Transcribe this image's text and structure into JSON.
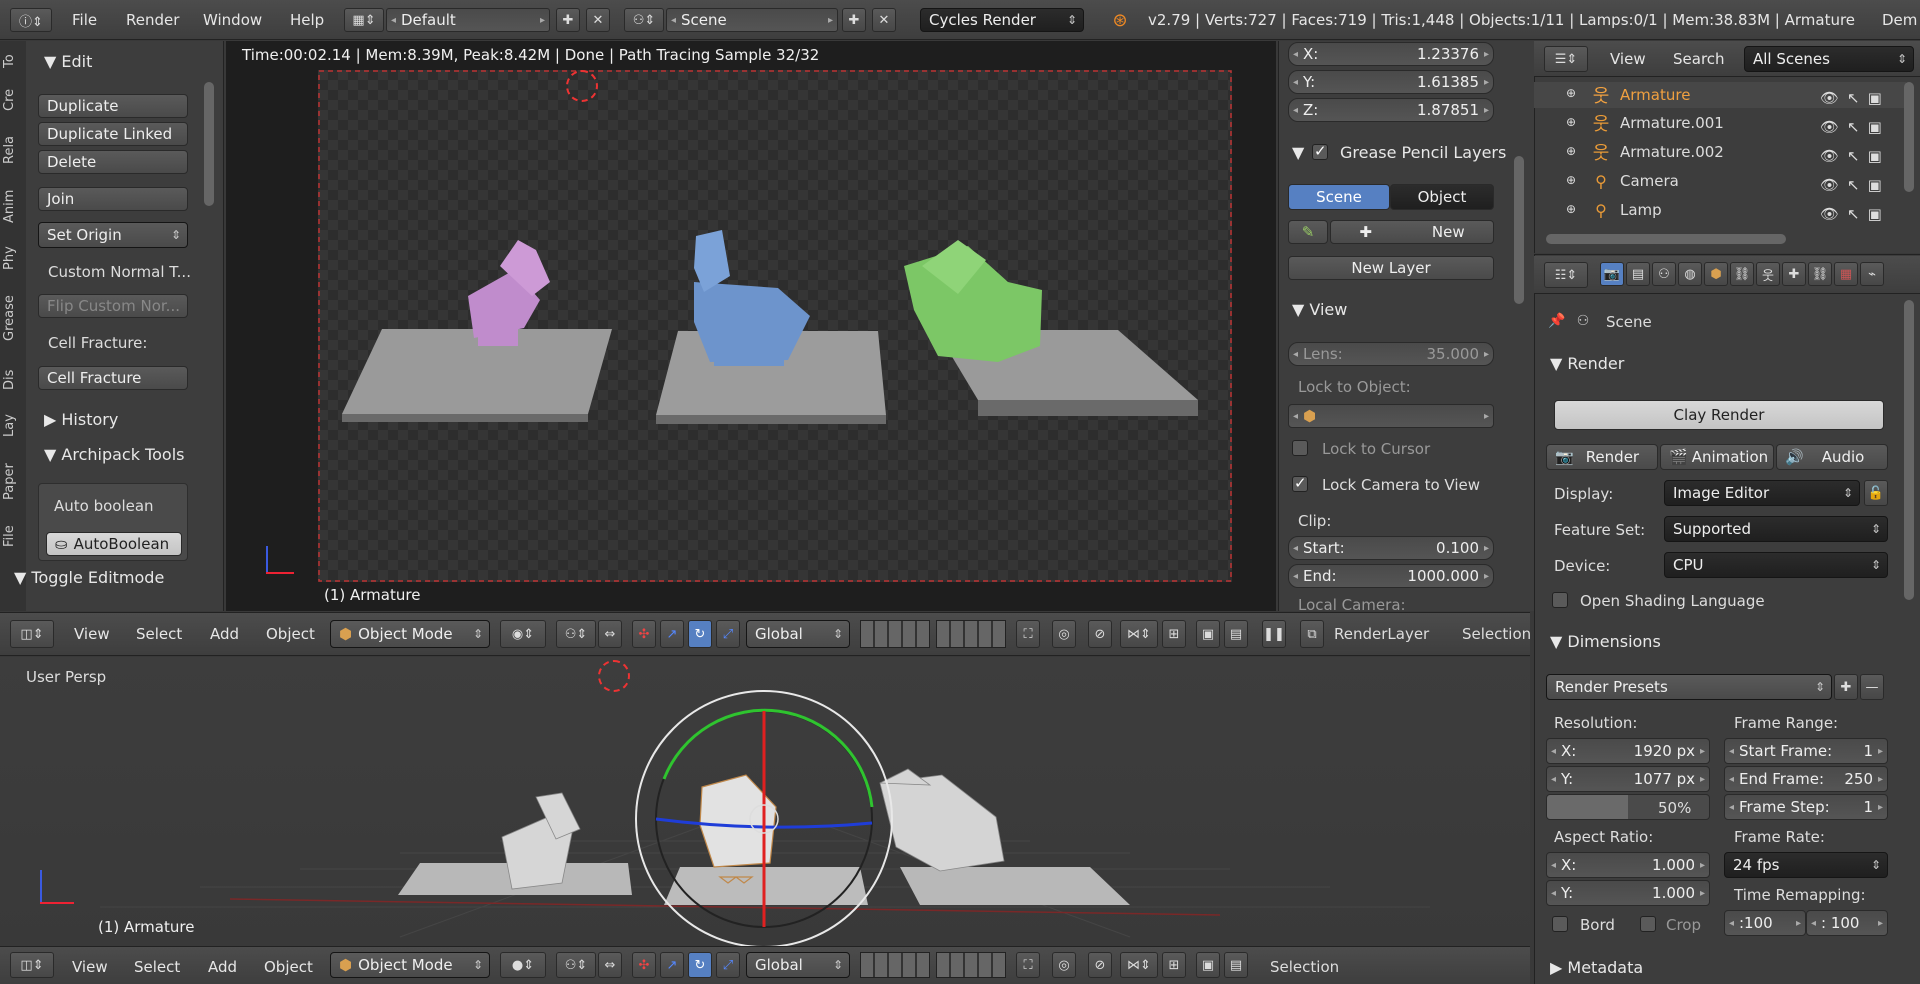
{
  "topbar": {
    "menus": [
      "File",
      "Render",
      "Window",
      "Help"
    ],
    "layout": "Default",
    "scene": "Scene",
    "engine": "Cycles Render",
    "stats": "v2.79 | Verts:727 | Faces:719 | Tris:1,448 | Objects:1/11 | Lamps:0/1 | Mem:38.83M | Armature",
    "stats_extra": "Dem"
  },
  "toolshelf": {
    "tabs": [
      "To",
      "Cre",
      "Rela",
      "Anim",
      "Phy",
      "Grease",
      "Dis",
      "Lay",
      "Paper",
      "File"
    ],
    "edit_header": "Edit",
    "buttons": {
      "duplicate": "Duplicate",
      "duplicate_linked": "Duplicate Linked",
      "delete": "Delete",
      "join": "Join",
      "set_origin": "Set Origin",
      "custom_normal": "Custom Normal T...",
      "flip_custom": "Flip Custom Nor...",
      "cell_fracture_label": "Cell Fracture:",
      "cell_fracture": "Cell Fracture"
    },
    "history": "History",
    "archipack": "Archipack Tools",
    "auto_boolean_label": "Auto boolean",
    "auto_boolean_btn": "AutoBoolean",
    "toggle_editmode": "Toggle Editmode"
  },
  "render_view": {
    "status": "Time:00:02.14 | Mem:8.39M, Peak:8.42M | Done | Path Tracing Sample 32/32",
    "object_label": "(1) Armature"
  },
  "n_panel": {
    "x_label": "X:",
    "x_val": "1.23376",
    "y_label": "Y:",
    "y_val": "1.61385",
    "z_label": "Z:",
    "z_val": "1.87851",
    "grease_header": "Grease Pencil Layers",
    "scene_tab": "Scene",
    "object_tab": "Object",
    "new": "New",
    "new_layer": "New Layer",
    "view_header": "View",
    "lens_label": "Lens:",
    "lens_val": "35.000",
    "lock_to_object": "Lock to Object:",
    "lock_cursor": "Lock to Cursor",
    "lock_camera": "Lock Camera to View",
    "clip": "Clip:",
    "start_label": "Start:",
    "start_val": "0.100",
    "end_label": "End:",
    "end_val": "1000.000",
    "local_camera": "Local Camera:"
  },
  "viewport_header": {
    "menus": [
      "View",
      "Select",
      "Add",
      "Object"
    ],
    "mode": "Object Mode",
    "orientation": "Global",
    "render_layer": "RenderLayer",
    "selection": "Selection"
  },
  "viewport3d": {
    "label": "User Persp",
    "object_label": "(1) Armature"
  },
  "bottom_header": {
    "menus": [
      "View",
      "Select",
      "Add",
      "Object"
    ],
    "mode": "Object Mode",
    "orientation": "Global",
    "selection": "Selection"
  },
  "outliner": {
    "view": "View",
    "search": "Search",
    "scenes": "All Scenes",
    "items": [
      "Armature",
      "Armature.001",
      "Armature.002",
      "Camera",
      "Lamp"
    ]
  },
  "properties": {
    "scene": "Scene",
    "render_header": "Render",
    "clay_render": "Clay Render",
    "render_btn": "Render",
    "animation_btn": "Animation",
    "audio_btn": "Audio",
    "display_label": "Display:",
    "display_val": "Image Editor",
    "feature_label": "Feature Set:",
    "feature_val": "Supported",
    "device_label": "Device:",
    "device_val": "CPU",
    "osl": "Open Shading Language",
    "dimensions_header": "Dimensions",
    "render_presets": "Render Presets",
    "resolution": "Resolution:",
    "res_x_label": "X:",
    "res_x": "1920 px",
    "res_y_label": "Y:",
    "res_y": "1077 px",
    "res_pct": "50%",
    "frame_range": "Frame Range:",
    "start_frame_label": "Start Frame:",
    "start_frame": "1",
    "end_frame_label": "End Frame:",
    "end_frame": "250",
    "frame_step_label": "Frame Step:",
    "frame_step": "1",
    "aspect": "Aspect Ratio:",
    "asp_x_label": "X:",
    "asp_x": "1.000",
    "asp_y_label": "Y:",
    "asp_y": "1.000",
    "frame_rate": "Frame Rate:",
    "fps": "24 fps",
    "bord": "Bord",
    "crop": "Crop",
    "time_remap": "Time Remapping:",
    "remap_old": ":100",
    "remap_new": ": 100",
    "metadata": "Metadata"
  },
  "colors": {
    "ui_bg": "#393939",
    "header_bg": "#444444",
    "accent_blue": "#5680c2",
    "render_bg": "#1f1f1f"
  }
}
